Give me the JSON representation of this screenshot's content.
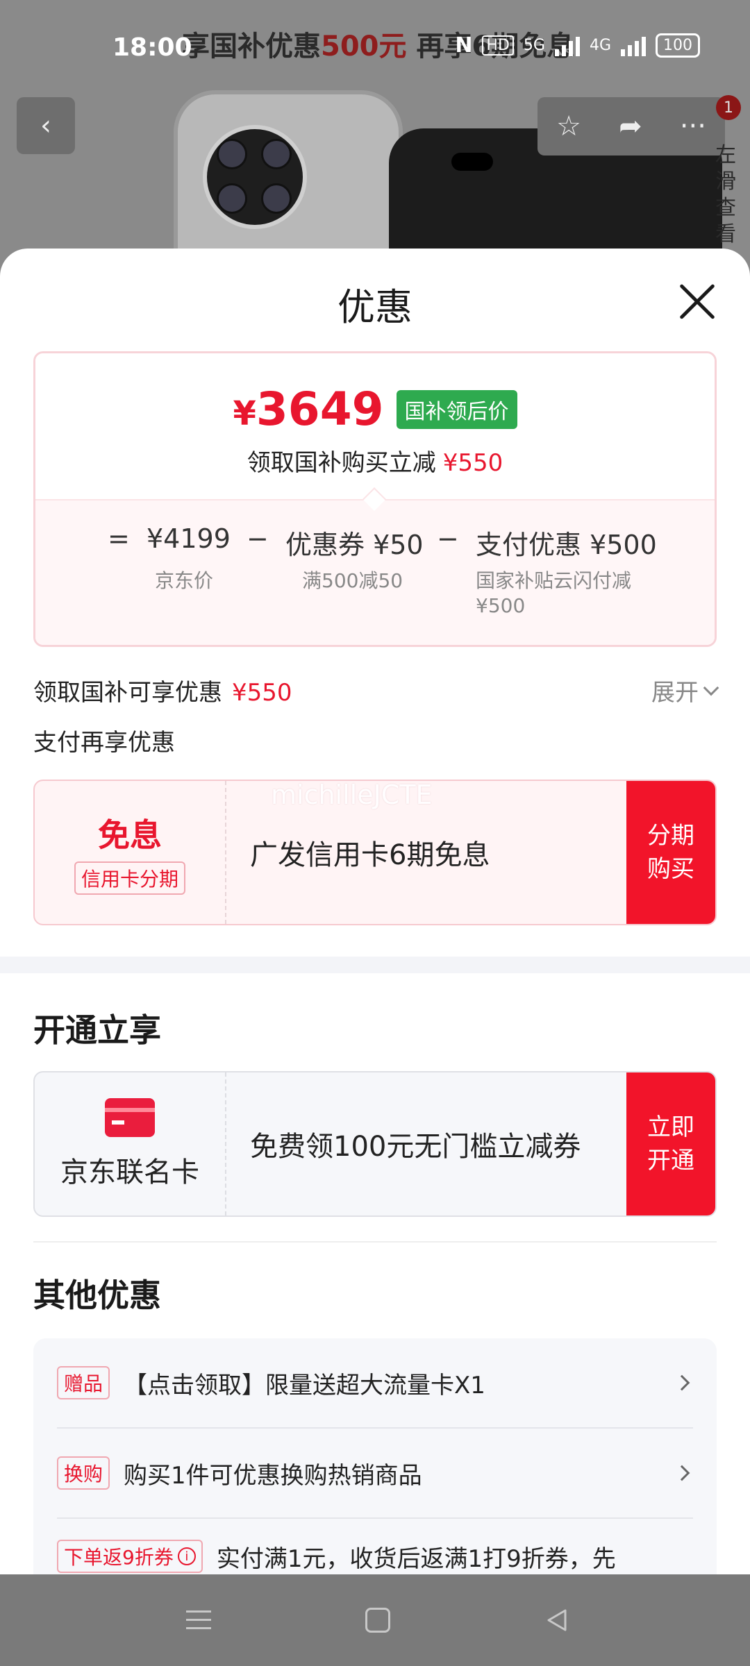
{
  "status_bar": {
    "time": "18:00",
    "net_5g": "5G",
    "net_4g": "4G",
    "hd": "HD",
    "battery": "100"
  },
  "background_page": {
    "banner_prefix": "享国补优惠",
    "banner_highlight": "500元",
    "banner_suffix": "再享6期免息",
    "cart_badge": "1",
    "side_hint": "左滑查看"
  },
  "sheet": {
    "title": "优惠",
    "price_card": {
      "currency": "¥",
      "final_price": "3649",
      "final_tag": "国补领后价",
      "summary_label": "领取国补购买立减",
      "summary_amount": "¥550",
      "eq": "=",
      "minus": "−",
      "items": [
        {
          "value": "¥4199",
          "label": "京东价"
        },
        {
          "value": "优惠券 ¥50",
          "label": "满500减50"
        },
        {
          "value": "支付优惠 ¥500",
          "label": "国家补贴云闪付减¥500"
        }
      ]
    },
    "guobu_row": {
      "label": "领取国补可享优惠",
      "amount": "¥550",
      "expand": "展开"
    },
    "pay_more": "支付再享优惠",
    "installment_card": {
      "title": "免息",
      "tag": "信用卡分期",
      "desc": "广发信用卡6期免息",
      "button": "分期购买",
      "watermark": "michilleJCTE"
    },
    "open_section": {
      "title": "开通立享",
      "card_label": "京东联名卡",
      "desc": "免费领100元无门槛立减券",
      "button": "立即开通"
    },
    "other_section": {
      "title": "其他优惠",
      "items": [
        {
          "tag": "赠品",
          "text": "【点击领取】限量送超大流量卡X1"
        },
        {
          "tag": "换购",
          "text": "购买1件可优惠换购热销商品"
        },
        {
          "tag": "下单返9折券",
          "text": "实付满1元，收货后返满1打9折券，先"
        }
      ]
    }
  },
  "colors": {
    "accent_red": "#e8162e",
    "button_red": "#f2142a",
    "tag_green": "#2eaa4f"
  }
}
